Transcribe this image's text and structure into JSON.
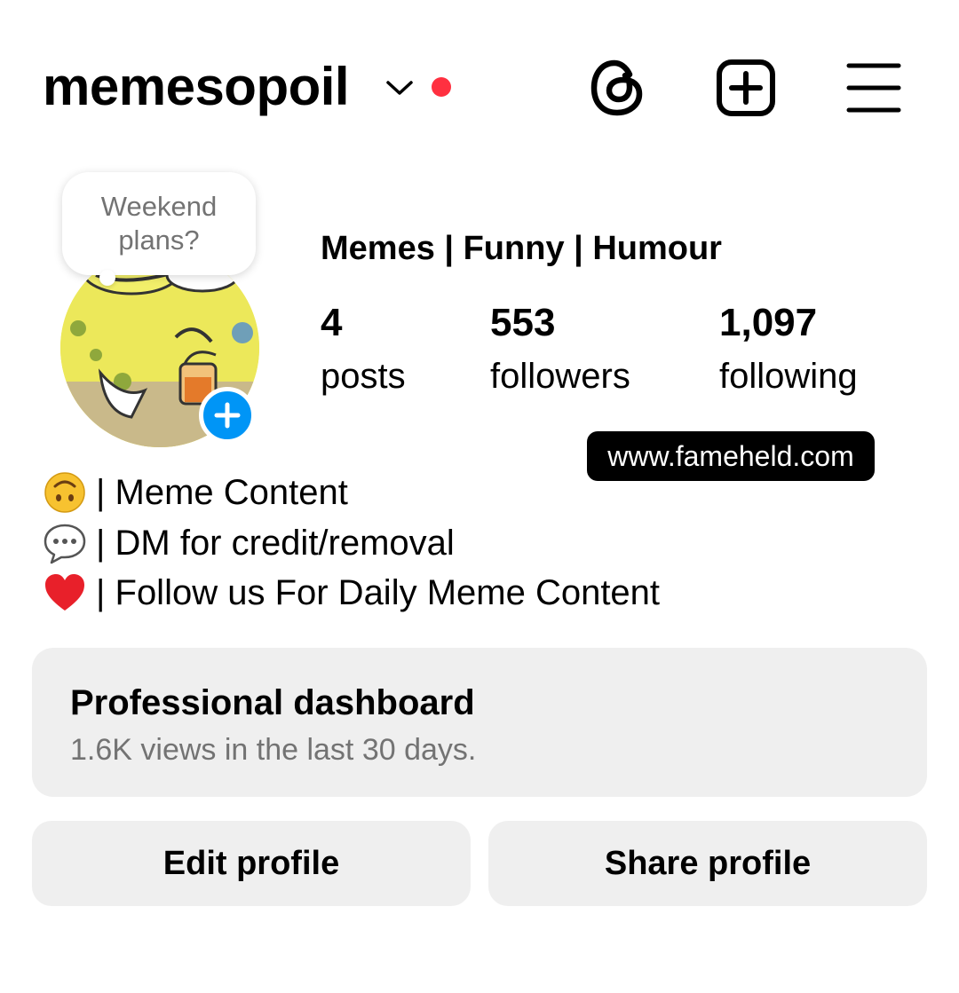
{
  "header": {
    "username": "memesopoil",
    "icons": [
      "chevron-down-icon",
      "notification-dot",
      "threads-icon",
      "add-content-icon",
      "menu-icon"
    ],
    "accent_dot_color": "#ff3040"
  },
  "note": {
    "text_line1": "Weekend",
    "text_line2": "plans?"
  },
  "profile": {
    "display_name": "Memes | Funny | Humour",
    "stats": [
      {
        "value": "4",
        "label": "posts"
      },
      {
        "value": "553",
        "label": "followers"
      },
      {
        "value": "1,097",
        "label": "following"
      }
    ],
    "add_story_color": "#0095f6"
  },
  "watermark": "www.fameheld.com",
  "bio": [
    {
      "emoji": "upside-down-face",
      "text": "| Meme Content"
    },
    {
      "emoji": "speech-balloon",
      "text": "| DM for credit/removal"
    },
    {
      "emoji": "red-heart",
      "text": "| Follow us For Daily Meme Content"
    }
  ],
  "dashboard": {
    "title": "Professional dashboard",
    "subtitle": "1.6K views in the last 30 days."
  },
  "buttons": {
    "edit": "Edit profile",
    "share": "Share profile"
  }
}
